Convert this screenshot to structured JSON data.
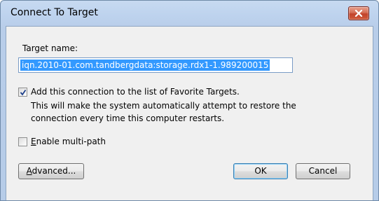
{
  "window": {
    "title": "Connect To Target"
  },
  "target": {
    "label": "Target name:",
    "value": "iqn.2010-01.com.tandbergdata:storage.rdx1-1.989200015"
  },
  "favorite": {
    "checked": true,
    "label": "Add this connection to the list of Favorite Targets.",
    "description_line1": "This will make the system automatically attempt to restore the",
    "description_line2": "connection every time this computer restarts."
  },
  "multipath": {
    "checked": false,
    "label_accel": "E",
    "label_rest": "nable multi-path"
  },
  "buttons": {
    "advanced_accel": "A",
    "advanced_rest": "dvanced...",
    "ok": "OK",
    "cancel": "Cancel"
  }
}
